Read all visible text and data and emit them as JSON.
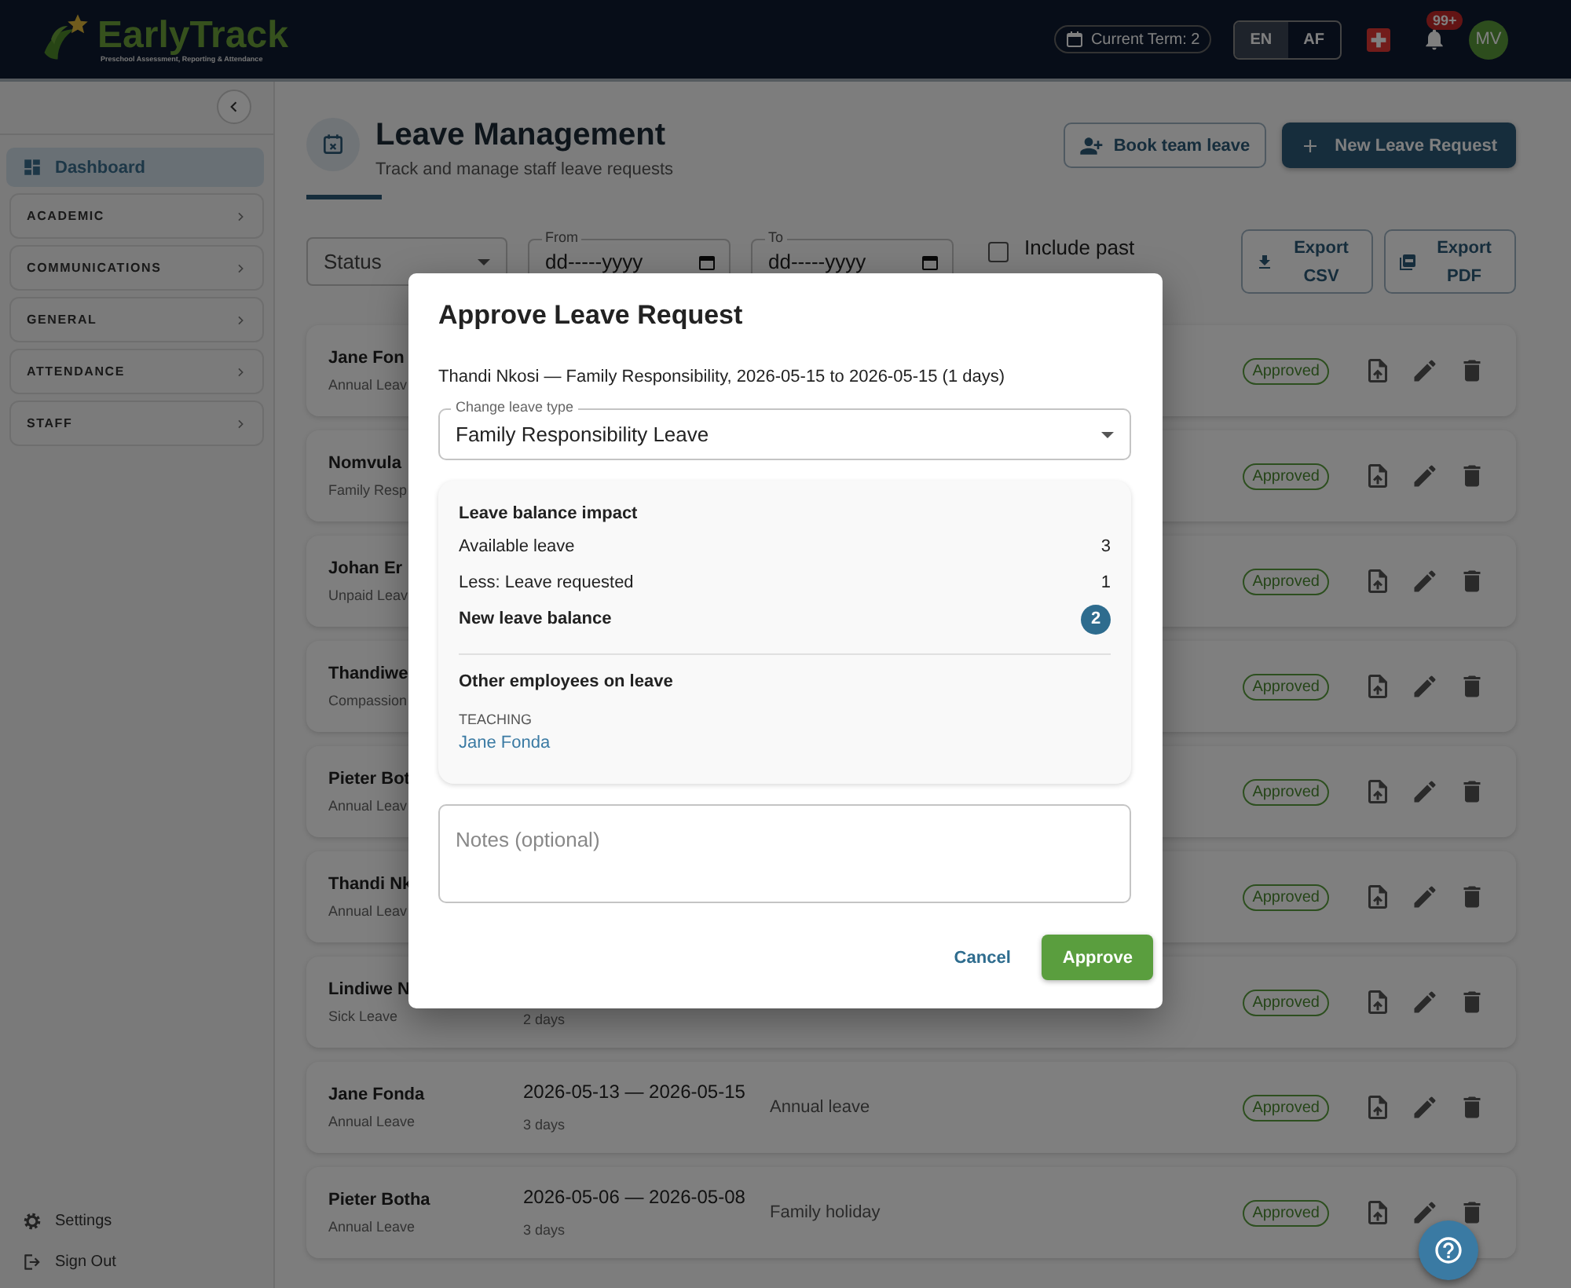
{
  "header": {
    "logo_name": "EarlyTrack",
    "logo_tagline": "Preschool Assessment, Reporting & Attendance",
    "term": "Current Term: 2",
    "languages": [
      {
        "label": "EN",
        "selected": true
      },
      {
        "label": "AF",
        "selected": false
      }
    ],
    "notification_count": "99+",
    "avatar": "MV"
  },
  "sidebar": {
    "items": [
      {
        "label": "Dashboard",
        "kind": "link",
        "selected": true
      },
      {
        "label": "ACADEMIC",
        "kind": "group",
        "selected": false
      },
      {
        "label": "COMMUNICATIONS",
        "kind": "group",
        "selected": false
      },
      {
        "label": "GENERAL",
        "kind": "group",
        "selected": false
      },
      {
        "label": "ATTENDANCE",
        "kind": "group",
        "selected": false
      },
      {
        "label": "STAFF",
        "kind": "group",
        "selected": false
      }
    ],
    "footer": [
      {
        "label": "Settings",
        "kind": "settings"
      },
      {
        "label": "Sign Out",
        "kind": "signout"
      }
    ]
  },
  "page": {
    "title": "Leave Management",
    "subtitle": "Track and manage staff leave requests",
    "actions": [
      {
        "label": "Book team leave",
        "kind": "secondary"
      },
      {
        "label": "New Leave Request",
        "kind": "primary"
      }
    ]
  },
  "filters": {
    "status_placeholder": "Status",
    "from": {
      "label": "From",
      "placeholder": "dd-----yyyy"
    },
    "to": {
      "label": "To",
      "placeholder": "dd-----yyyy"
    },
    "include_past": {
      "label": "Include past",
      "checked": false
    },
    "exports": [
      {
        "label": "Export CSV",
        "kind": "csv"
      },
      {
        "label": "Export PDF",
        "kind": "pdf"
      }
    ]
  },
  "requests": [
    {
      "name": "Jane Fon",
      "type": "Annual Leav",
      "status": "Approved"
    },
    {
      "name": "Nomvula",
      "type": "Family Resp",
      "status": "Approved"
    },
    {
      "name": "Johan Er",
      "type": "Unpaid Leav",
      "status": "Approved"
    },
    {
      "name": "Thandiwe",
      "type": "Compassion",
      "status": "Approved"
    },
    {
      "name": "Pieter Bot",
      "type": "Annual Leav",
      "status": "Approved"
    },
    {
      "name": "Thandi Nk",
      "type": "Annual Leav",
      "status": "Approved"
    },
    {
      "name": "Lindiwe N",
      "type": "Sick Leave",
      "duration": "2 days",
      "status": "Approved"
    },
    {
      "name": "Jane Fonda",
      "type": "Annual Leave",
      "dates": "2026-05-13 — 2026-05-15",
      "duration": "3 days",
      "reason": "Annual leave",
      "status": "Approved"
    },
    {
      "name": "Pieter Botha",
      "type": "Annual Leave",
      "dates": "2026-05-06 — 2026-05-08",
      "duration": "3 days",
      "reason": "Family holiday",
      "status": "Approved"
    }
  ],
  "modal": {
    "title": "Approve Leave Request",
    "summary": "Thandi Nkosi — Family Responsibility, 2026-05-15 to 2026-05-15 (1 days)",
    "leave_type": {
      "label": "Change leave type",
      "value": "Family Responsibility Leave"
    },
    "impact": {
      "title": "Leave balance impact",
      "rows": [
        {
          "label": "Available leave",
          "value": "3",
          "kind": "plain"
        },
        {
          "label": "Less: Leave requested",
          "value": "1",
          "kind": "plain"
        },
        {
          "label": "New leave balance",
          "value": "2",
          "kind": "total"
        }
      ]
    },
    "others": {
      "title": "Other employees on leave",
      "groups": [
        {
          "name": "TEACHING",
          "people": [
            "Jane Fonda"
          ]
        }
      ]
    },
    "notes_placeholder": "Notes (optional)",
    "buttons": [
      {
        "label": "Cancel",
        "kind": "text"
      },
      {
        "label": "Approve",
        "kind": "primary"
      }
    ]
  }
}
